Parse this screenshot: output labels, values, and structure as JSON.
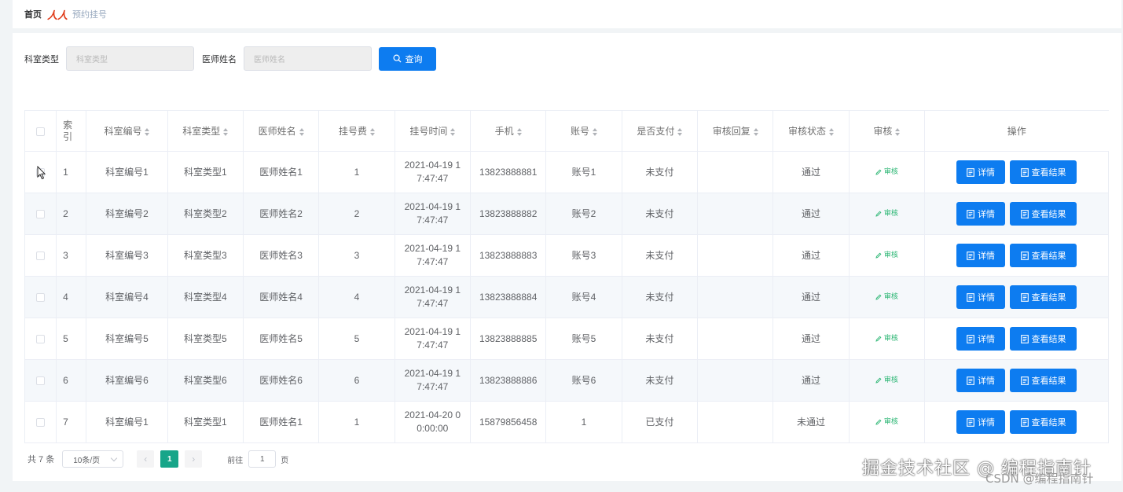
{
  "breadcrumb": {
    "home": "首页",
    "separator": "人人",
    "current": "预约挂号"
  },
  "search": {
    "dept_type_label": "科室类型",
    "dept_type_placeholder": "科室类型",
    "doctor_label": "医师姓名",
    "doctor_placeholder": "医师姓名",
    "query_label": "查询"
  },
  "table": {
    "headers": {
      "index": "索引",
      "dept_no": "科室编号",
      "dept_type": "科室类型",
      "doctor": "医师姓名",
      "fee": "挂号费",
      "time": "挂号时间",
      "phone": "手机",
      "account": "账号",
      "paid": "是否支付",
      "reply": "审核回复",
      "status": "审核状态",
      "audit": "审核",
      "ops": "操作"
    },
    "rows": [
      {
        "index": "1",
        "dept_no": "科室编号1",
        "dept_type": "科室类型1",
        "doctor": "医师姓名1",
        "fee": "1",
        "time": "2021-04-19 17:47:47",
        "phone": "13823888881",
        "account": "账号1",
        "paid": "未支付",
        "reply": "",
        "status": "通过",
        "audit": "审核"
      },
      {
        "index": "2",
        "dept_no": "科室编号2",
        "dept_type": "科室类型2",
        "doctor": "医师姓名2",
        "fee": "2",
        "time": "2021-04-19 17:47:47",
        "phone": "13823888882",
        "account": "账号2",
        "paid": "未支付",
        "reply": "",
        "status": "通过",
        "audit": "审核"
      },
      {
        "index": "3",
        "dept_no": "科室编号3",
        "dept_type": "科室类型3",
        "doctor": "医师姓名3",
        "fee": "3",
        "time": "2021-04-19 17:47:47",
        "phone": "13823888883",
        "account": "账号3",
        "paid": "未支付",
        "reply": "",
        "status": "通过",
        "audit": "审核"
      },
      {
        "index": "4",
        "dept_no": "科室编号4",
        "dept_type": "科室类型4",
        "doctor": "医师姓名4",
        "fee": "4",
        "time": "2021-04-19 17:47:47",
        "phone": "13823888884",
        "account": "账号4",
        "paid": "未支付",
        "reply": "",
        "status": "通过",
        "audit": "审核"
      },
      {
        "index": "5",
        "dept_no": "科室编号5",
        "dept_type": "科室类型5",
        "doctor": "医师姓名5",
        "fee": "5",
        "time": "2021-04-19 17:47:47",
        "phone": "13823888885",
        "account": "账号5",
        "paid": "未支付",
        "reply": "",
        "status": "通过",
        "audit": "审核"
      },
      {
        "index": "6",
        "dept_no": "科室编号6",
        "dept_type": "科室类型6",
        "doctor": "医师姓名6",
        "fee": "6",
        "time": "2021-04-19 17:47:47",
        "phone": "13823888886",
        "account": "账号6",
        "paid": "未支付",
        "reply": "",
        "status": "通过",
        "audit": "审核"
      },
      {
        "index": "7",
        "dept_no": "科室编号1",
        "dept_type": "科室类型1",
        "doctor": "医师姓名1",
        "fee": "1",
        "time": "2021-04-20 00:00:00",
        "phone": "15879856458",
        "account": "1",
        "paid": "已支付",
        "reply": "",
        "status": "未通过",
        "audit": "审核"
      }
    ],
    "detail_label": "详情",
    "result_label": "查看结果"
  },
  "pagination": {
    "total": "共 7 条",
    "page_size": "10条/页",
    "current_page": "1",
    "goto_label": "前往",
    "goto_value": "1",
    "page_unit": "页"
  },
  "watermark": {
    "main": "掘金技术社区 @ 编程指南针",
    "sub": "CSDN @编程指南针"
  },
  "colors": {
    "primary": "#0d7cf0",
    "active_page": "#17a589",
    "audit_text": "#2bb673",
    "breadcrumb_separator": "#e03b1a"
  },
  "icons": {
    "search": "search-icon",
    "document": "document-icon",
    "edit": "edit-icon",
    "cursor": "mouse-cursor-icon"
  }
}
